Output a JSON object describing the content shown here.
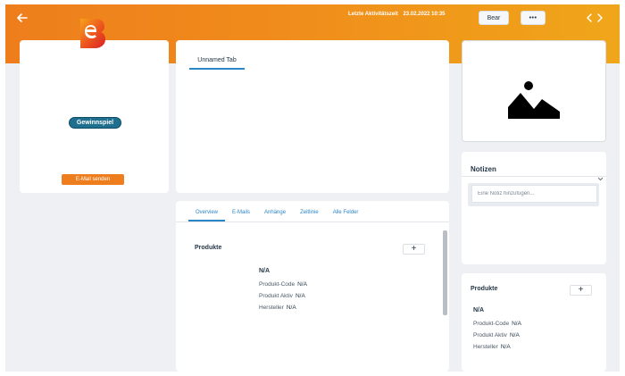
{
  "topbar": {
    "last_activity_label": "Letzte Aktivitätszeit",
    "last_activity_date": "23.02.2022 10:35",
    "bear_label": "Bear",
    "more_label": "•••"
  },
  "contact": {
    "badge_label": "Gewinnspiel",
    "email_button_label": "E-Mail senden"
  },
  "center_tabs": {
    "unnamed_tab_label": "Unnamed Tab"
  },
  "notes": {
    "title": "Notizen",
    "placeholder": "Eine Notiz hinzufügen..."
  },
  "main_tabs": [
    {
      "label": "Overview"
    },
    {
      "label": "E-Mails"
    },
    {
      "label": "Anhänge"
    },
    {
      "label": "Zeitlinie"
    },
    {
      "label": "Alle Felder"
    }
  ],
  "products_main": {
    "title": "Produkte",
    "add_label": "+",
    "name": "N/A",
    "fields": [
      {
        "label": "Produkt-Code",
        "value": "N/A"
      },
      {
        "label": "Produkt Aktiv",
        "value": "N/A"
      },
      {
        "label": "Hersteller",
        "value": "N/A"
      }
    ]
  },
  "products_side": {
    "title": "Produkte",
    "add_label": "+",
    "name": "N/A",
    "fields": [
      {
        "label": "Produkt-Code",
        "value": "N/A"
      },
      {
        "label": "Produkt Aktiv",
        "value": "N/A"
      },
      {
        "label": "Hersteller",
        "value": "N/A"
      }
    ]
  },
  "colors": {
    "banner_start": "#ee7e1c",
    "banner_end": "#f0a61a",
    "accent_blue": "#2a86c7",
    "email_button": "#ed7d1d",
    "badge": "#1f6f8f"
  },
  "icons": {
    "back": "arrow-left-icon",
    "prev": "chevron-left-icon",
    "next": "chevron-right-icon",
    "image": "image-placeholder-icon",
    "notes_toggle": "chevron-down-icon"
  }
}
